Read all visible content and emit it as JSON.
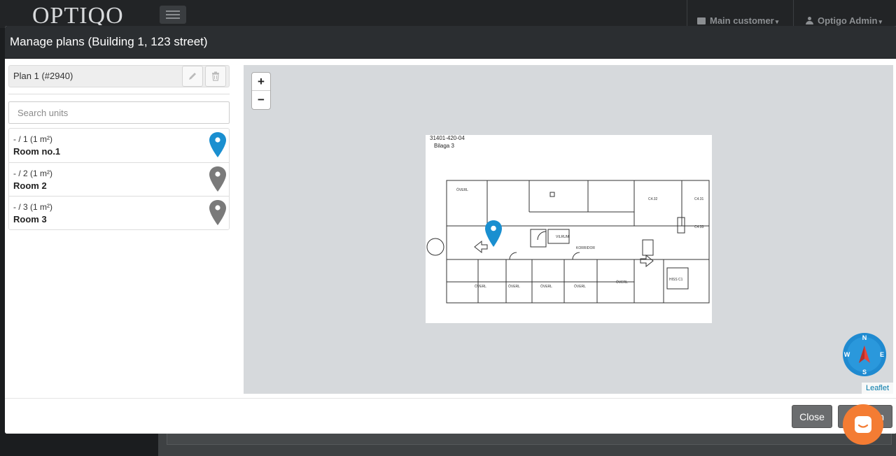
{
  "app": {
    "logo": "OPTIQO",
    "customer_menu": "Main customer",
    "user_menu": "Optigo Admin"
  },
  "modal": {
    "title": "Manage plans (Building 1, 123 street)",
    "plan_label": "Plan 1 (#2940)",
    "search_placeholder": "Search units",
    "units": [
      {
        "code": "- / 1 (1 m²)",
        "name": "Room no.1",
        "pin_color": "#1a8fd0"
      },
      {
        "code": "- / 2 (1 m²)",
        "name": "Room 2",
        "pin_color": "#7a7a7a"
      },
      {
        "code": "- / 3 (1 m²)",
        "name": "Room 3",
        "pin_color": "#7a7a7a"
      }
    ],
    "close_label": "Close",
    "save_label": "n"
  },
  "map": {
    "zoom_in": "+",
    "zoom_out": "−",
    "plan_code": "31401-420-04",
    "plan_sub": "Bilaga 3",
    "attribution": "Leaflet",
    "compass": {
      "n": "N",
      "s": "S",
      "e": "E",
      "w": "W"
    },
    "pin_color": "#1a8fd0"
  },
  "colors": {
    "header_bg": "#2b2e31",
    "chat_accent": "#f47c33",
    "map_bg": "#d6d9dc"
  }
}
